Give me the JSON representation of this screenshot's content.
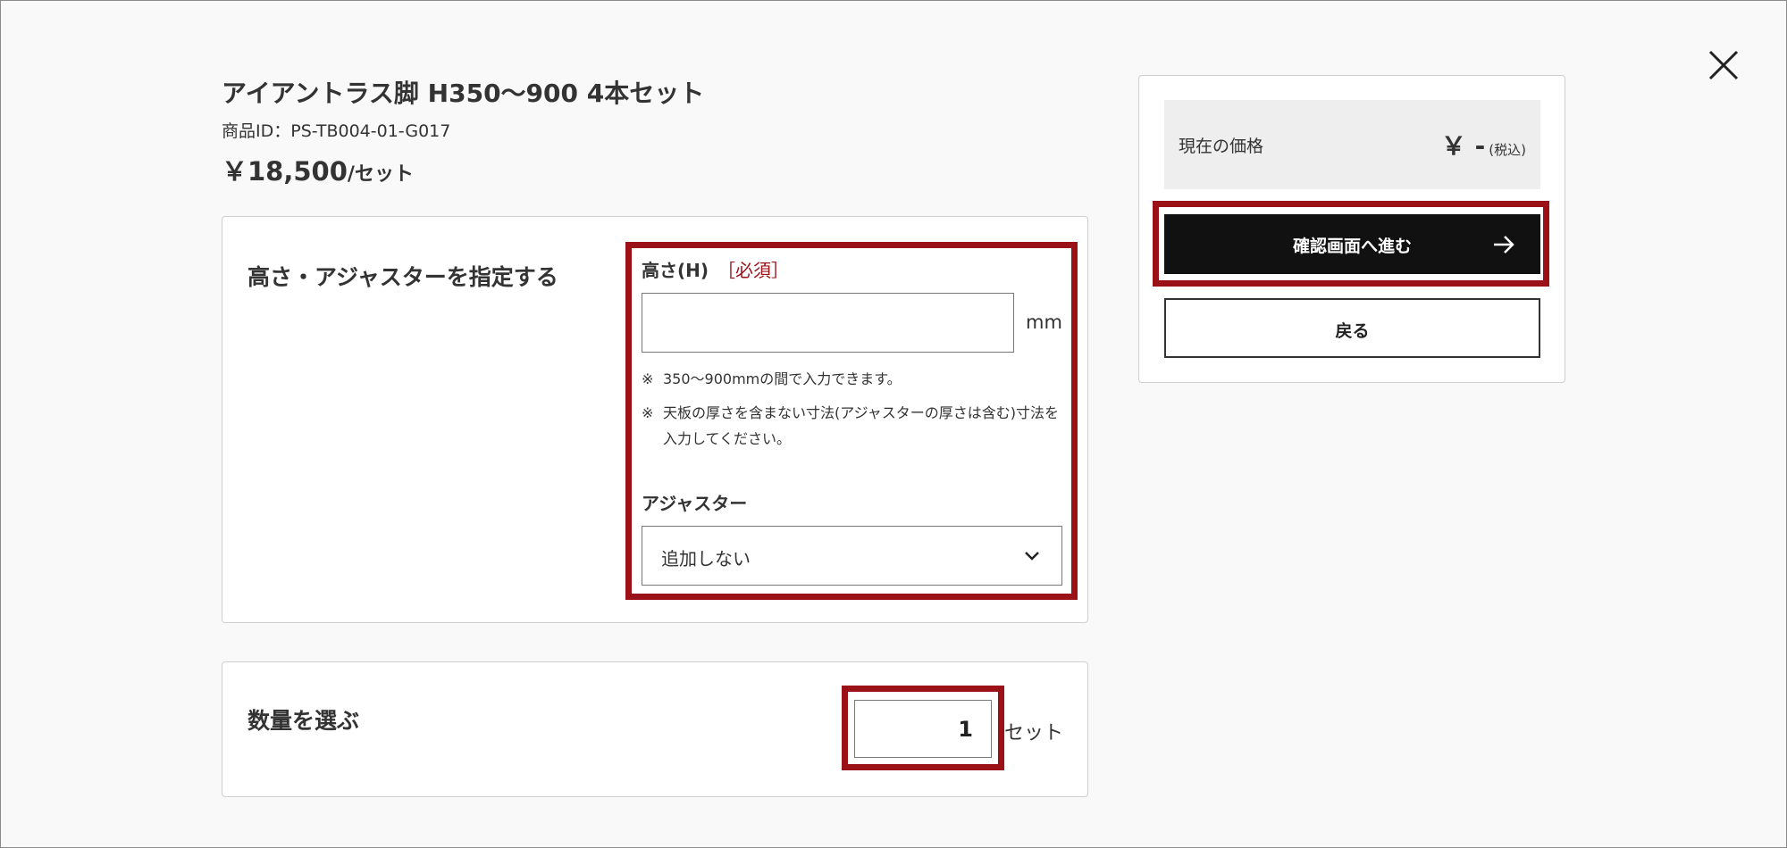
{
  "dialog": {
    "close_icon": "close-icon"
  },
  "product": {
    "title": "アイアントラス脚 H350〜900 4本セット",
    "id_text": "商品ID：PS-TB004-01-G017",
    "price_amount": "￥18,500",
    "price_unit": "/セット"
  },
  "spec_section": {
    "title": "高さ・アジャスターを指定する",
    "height_label": "高さ(H)",
    "required_label": "［必須］",
    "height_value": "",
    "height_unit": "mm",
    "note_mark": "※",
    "notes": [
      "350〜900mmの間で入力できます。",
      "天板の厚さを含まない寸法(アジャスターの厚さは含む)寸法を入力してください。"
    ],
    "adjuster_label": "アジャスター",
    "adjuster_selected": "追加しない",
    "chevron_icon": "chevron-down-icon"
  },
  "quantity_section": {
    "title": "数量を選ぶ",
    "value": "1",
    "unit": "セット"
  },
  "summary": {
    "current_price_label": "現在の価格",
    "current_price_value": "￥ -",
    "tax_label": "(税込)",
    "confirm_button_label": "確認画面へ進む",
    "confirm_arrow_icon": "arrow-right-icon",
    "back_button_label": "戻る"
  },
  "colors": {
    "highlight": "#9b1118",
    "primary_button": "#111111",
    "price_box": "#eeeeee",
    "background": "#f9f9f9"
  }
}
